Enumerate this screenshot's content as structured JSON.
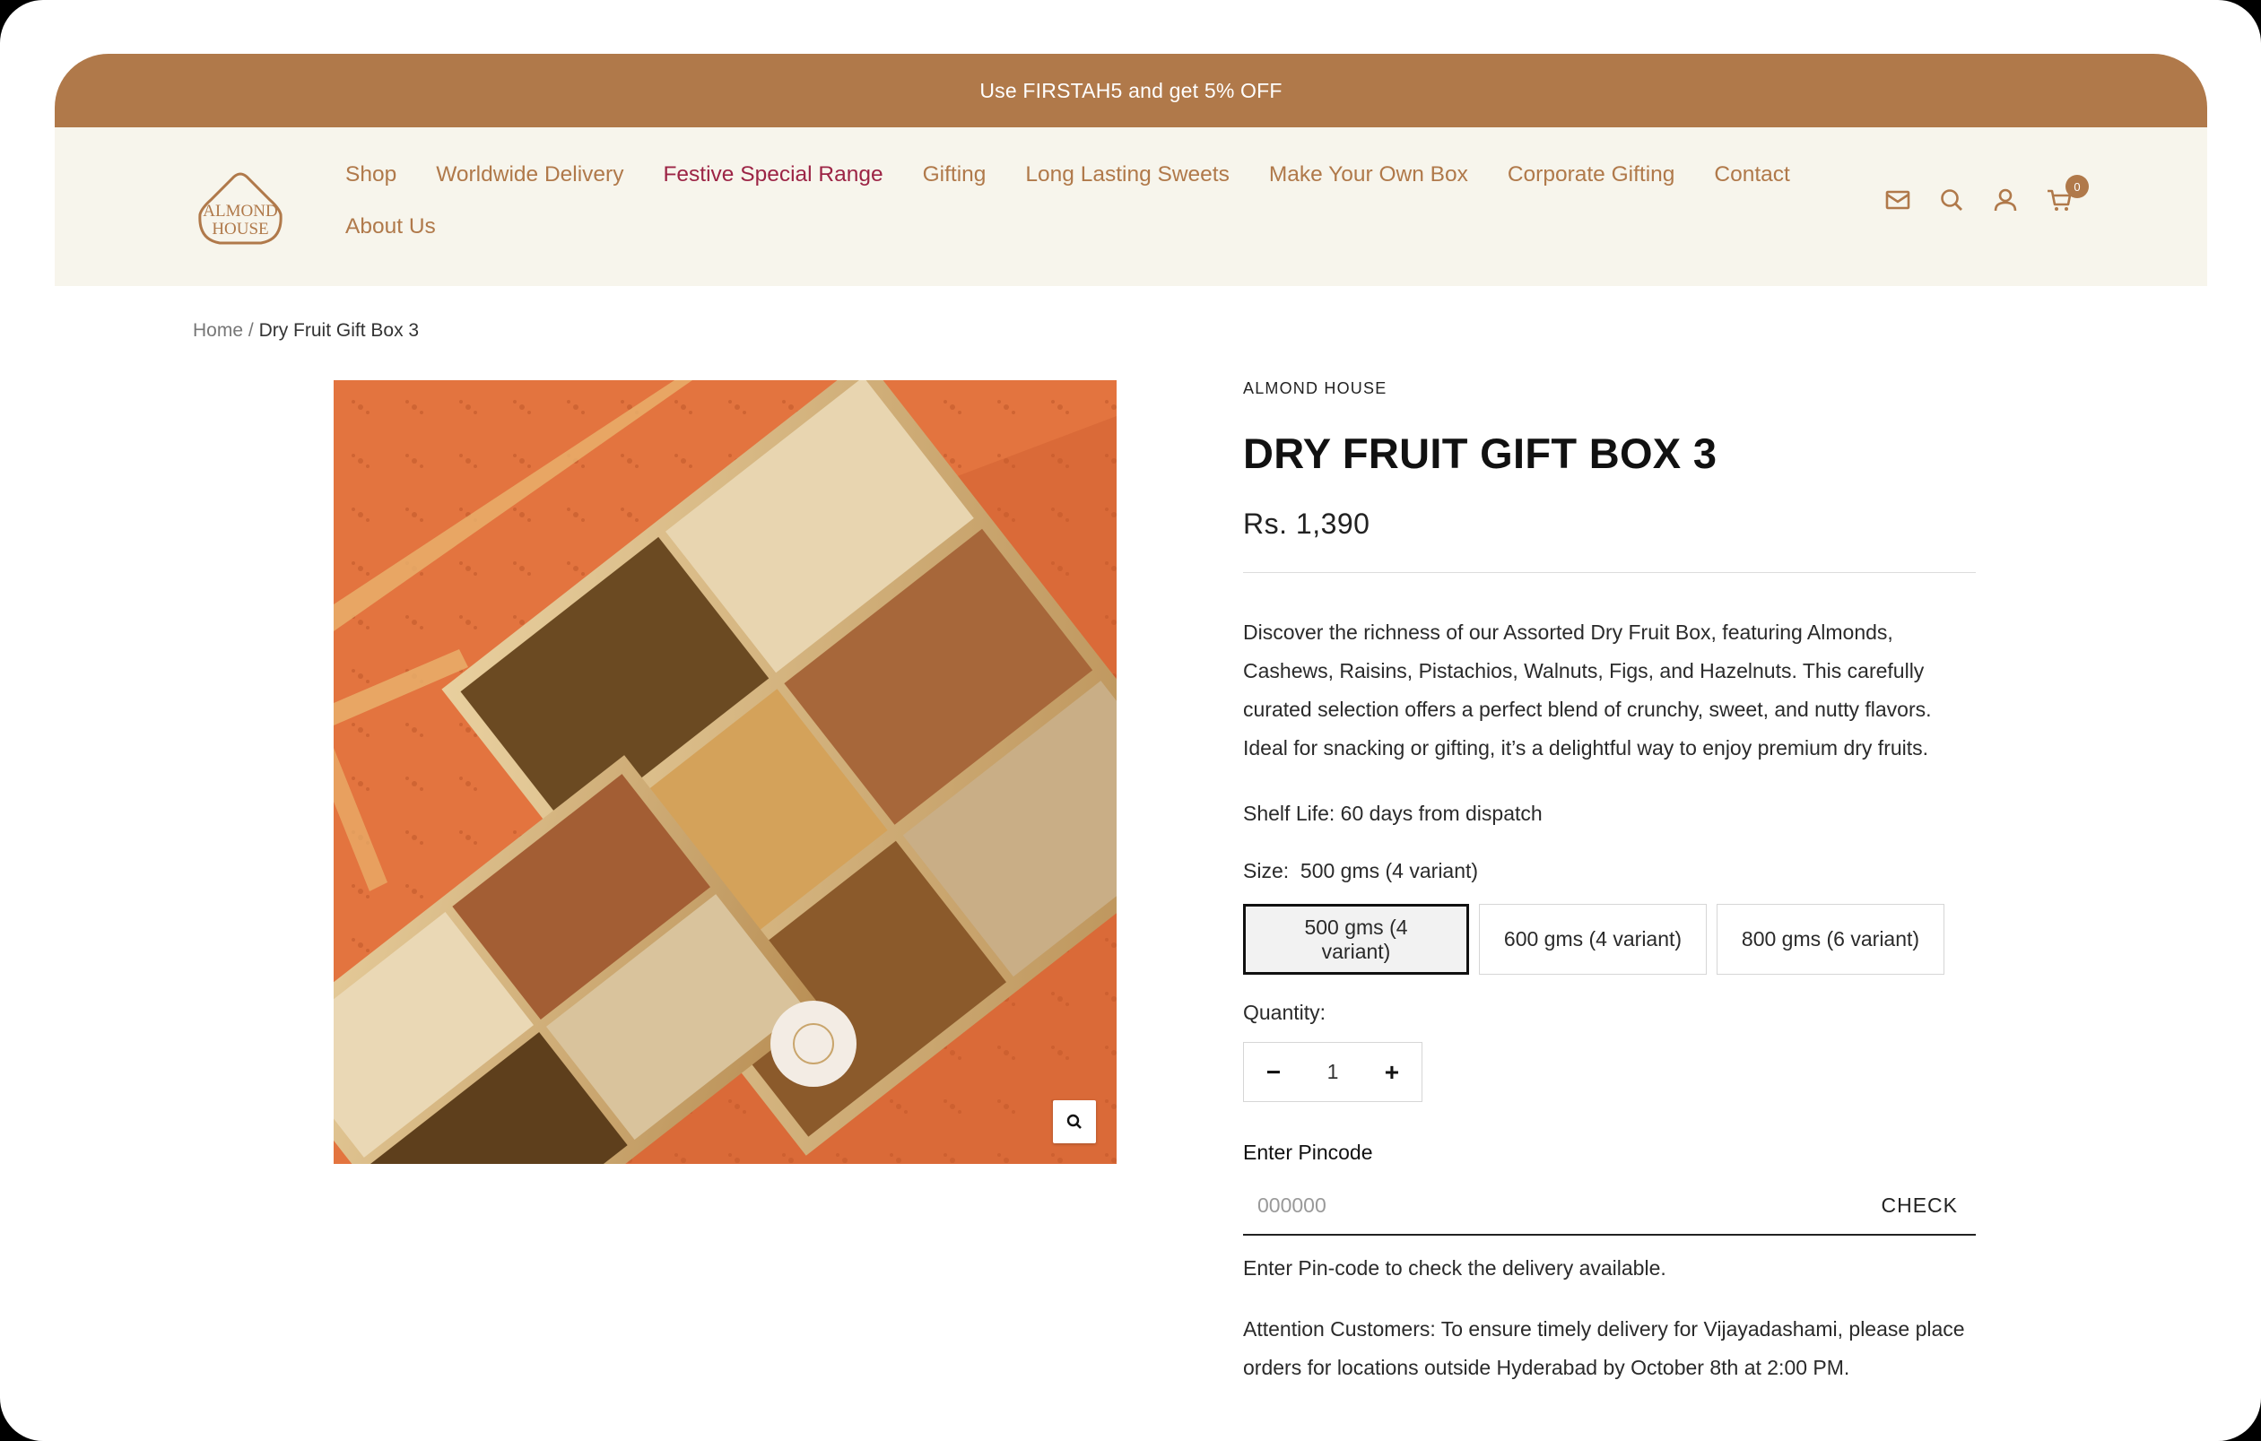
{
  "announcement": {
    "text": "Use FIRSTAH5 and get 5% OFF"
  },
  "header": {
    "logo_text_line1": "ALMOND",
    "logo_text_line2": "HOUSE",
    "nav": [
      {
        "label": "Shop"
      },
      {
        "label": "Worldwide Delivery"
      },
      {
        "label": "Festive Special Range"
      },
      {
        "label": "Gifting"
      },
      {
        "label": "Long Lasting Sweets"
      },
      {
        "label": "Make Your Own Box"
      },
      {
        "label": "Corporate Gifting"
      },
      {
        "label": "Contact"
      },
      {
        "label": "About Us"
      }
    ],
    "icons": [
      "mail-icon",
      "search-icon",
      "account-icon",
      "cart-icon"
    ],
    "cart_count": "0"
  },
  "breadcrumb": {
    "home": "Home",
    "separator": "/",
    "current": "Dry Fruit Gift Box 3"
  },
  "product": {
    "vendor": "ALMOND HOUSE",
    "title": "DRY FRUIT GIFT BOX 3",
    "price": "Rs. 1,390",
    "description": "Discover the richness of our Assorted Dry Fruit Box, featuring Almonds, Cashews, Raisins, Pistachios, Walnuts, Figs, and Hazelnuts. This carefully curated selection offers a perfect blend of crunchy, sweet, and nutty flavors. Ideal for snacking or gifting, it’s a delightful way to enjoy premium dry fruits.",
    "shelf_life": "Shelf Life: 60 days from dispatch",
    "size_label": "Size:",
    "size_selected": "500 gms (4 variant)",
    "variants": [
      {
        "label": "500 gms (4 variant)",
        "selected": true
      },
      {
        "label": "600 gms (4 variant)",
        "selected": false
      },
      {
        "label": "800 gms (6 variant)",
        "selected": false
      }
    ],
    "quantity_label": "Quantity:",
    "quantity_value": "1",
    "qty_minus": "−",
    "qty_plus": "+",
    "pincode_label": "Enter Pincode",
    "pincode_placeholder": "000000",
    "check_label": "CHECK",
    "pincode_help": "Enter Pin-code to check the delivery available.",
    "attention": "Attention Customers: To ensure timely delivery for Vijayadashami, please place orders for locations outside Hyderabad by October 8th at 2:00 PM."
  },
  "colors": {
    "brand": "#b0794a",
    "festive": "#9c2445",
    "header_bg": "#f7f5ec"
  }
}
